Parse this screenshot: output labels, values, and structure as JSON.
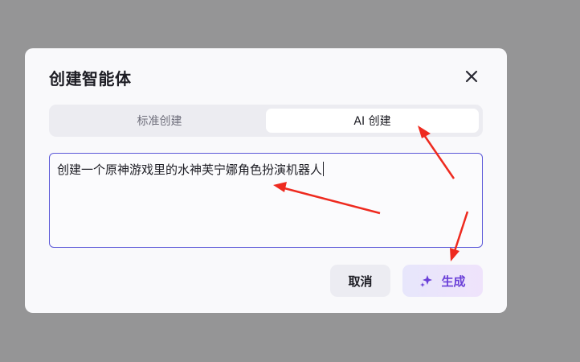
{
  "dialog": {
    "title": "创建智能体",
    "close_icon": "close-icon"
  },
  "tabs": [
    {
      "label": "标准创建",
      "active": false
    },
    {
      "label": "AI 创建",
      "active": true
    }
  ],
  "prompt": {
    "value": "创建一个原神游戏里的水神芙宁娜角色扮演机器人"
  },
  "buttons": {
    "cancel_label": "取消",
    "generate_label": "生成",
    "generate_icon": "sparkle-icon"
  },
  "colors": {
    "accent": "#5b57d8",
    "generate_text": "#6a3fd8",
    "annotation_arrow": "#ee2a1f",
    "backdrop": "#959595"
  }
}
